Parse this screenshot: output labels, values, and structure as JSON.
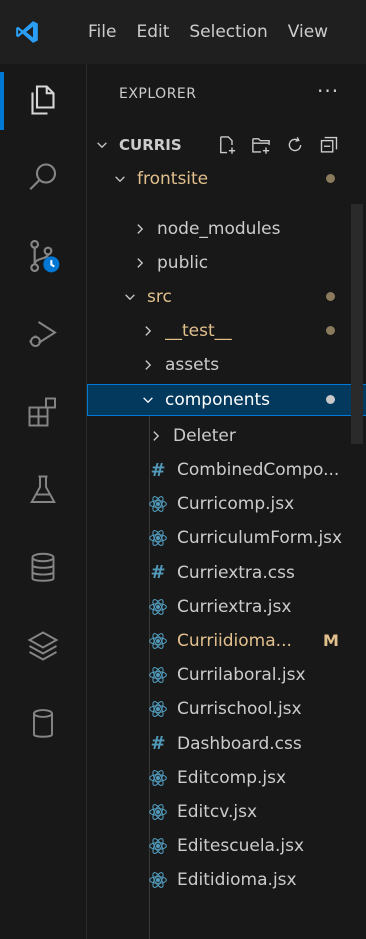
{
  "titlebar": {
    "menu": [
      "File",
      "Edit",
      "Selection",
      "View"
    ]
  },
  "activity": [
    "explorer-icon",
    "search-icon",
    "source-control-icon",
    "run-debug-icon",
    "extensions-icon",
    "testing-icon",
    "database-icon",
    "layers-icon",
    "cylinder-icon"
  ],
  "explorer": {
    "title": "EXPLORER",
    "more": "···",
    "root": "CURRIS",
    "frontsite": "frontsite",
    "assets_partial": "assets",
    "node_modules": "node_modules",
    "public": "public",
    "src": "src",
    "test": "__test__",
    "assets": "assets",
    "components": "components",
    "deleter": "Deleter"
  },
  "files": [
    {
      "name": "CombinedCompo...",
      "type": "css"
    },
    {
      "name": "Curricomp.jsx",
      "type": "react"
    },
    {
      "name": "CurriculumForm.jsx",
      "type": "react"
    },
    {
      "name": "Curriextra.css",
      "type": "css"
    },
    {
      "name": "Curriextra.jsx",
      "type": "react"
    },
    {
      "name": "Curriidioma...",
      "type": "react",
      "modified": true,
      "badge": "M"
    },
    {
      "name": "Currilaboral.jsx",
      "type": "react"
    },
    {
      "name": "Currischool.jsx",
      "type": "react"
    },
    {
      "name": "Dashboard.css",
      "type": "css"
    },
    {
      "name": "Editcomp.jsx",
      "type": "react"
    },
    {
      "name": "Editcv.jsx",
      "type": "react"
    },
    {
      "name": "Editescuela.jsx",
      "type": "react"
    },
    {
      "name": "Editidioma.jsx",
      "type": "react"
    }
  ],
  "colors": {
    "accent": "#0078d4",
    "react": "#519aba",
    "modified": "#e2c08d"
  }
}
